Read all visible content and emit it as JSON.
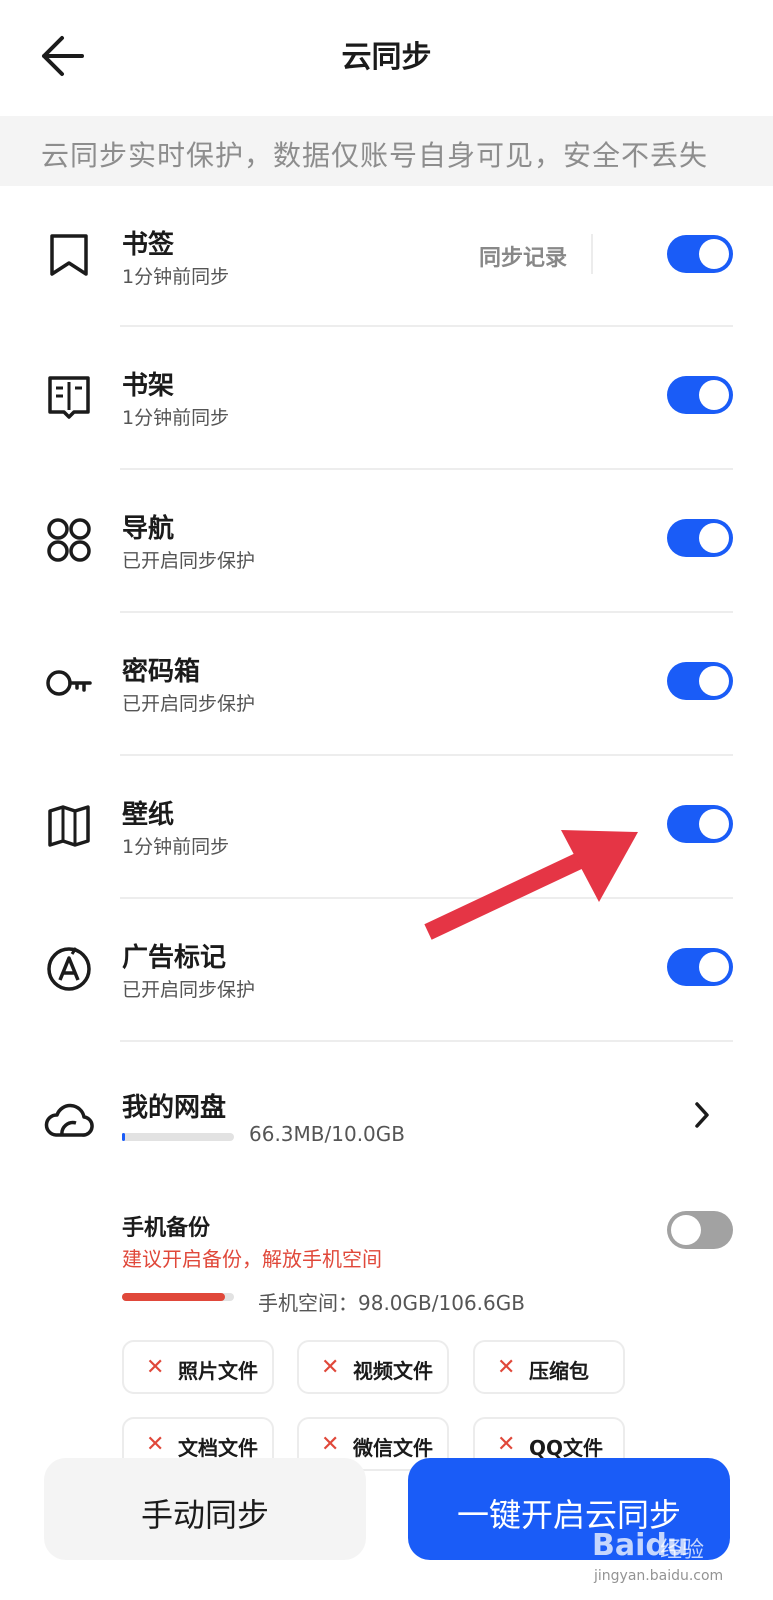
{
  "header": {
    "title": "云同步"
  },
  "notice": {
    "text": "云同步实时保护，数据仅账号自身可见，安全不丢失"
  },
  "items": [
    {
      "icon": "bookmark-icon",
      "title": "书签",
      "status": "1分钟前同步",
      "enabled": true,
      "action": "同步记录"
    },
    {
      "icon": "bookshelf-icon",
      "title": "书架",
      "status": "1分钟前同步",
      "enabled": true
    },
    {
      "icon": "navigation-grid-icon",
      "title": "导航",
      "status": "已开启同步保护",
      "enabled": true
    },
    {
      "icon": "key-icon",
      "title": "密码箱",
      "status": "已开启同步保护",
      "enabled": true
    },
    {
      "icon": "wallpaper-map-icon",
      "title": "壁纸",
      "status": "1分钟前同步",
      "enabled": true
    },
    {
      "icon": "ad-mark-icon",
      "title": "广告标记",
      "status": "已开启同步保护",
      "enabled": true
    }
  ],
  "cloud_disk": {
    "icon": "cloud-icon",
    "title": "我的网盘",
    "usage": "66.3MB/10.0GB",
    "usage_fraction": 0.0066
  },
  "phone_backup": {
    "title": "手机备份",
    "warning": "建议开启备份，解放手机空间",
    "enabled": false,
    "space_label": "手机空间：",
    "space_value": "98.0GB/106.6GB",
    "usage_fraction": 0.92,
    "categories": [
      "照片文件",
      "视频文件",
      "压缩包",
      "文档文件",
      "微信文件",
      "QQ文件"
    ]
  },
  "footer": {
    "manual_sync": "手动同步",
    "one_key_sync": "一键开启云同步"
  },
  "watermark": {
    "brand": "Baidu",
    "sub": "经验",
    "url": "jingyan.baidu.com"
  },
  "colors": {
    "accent": "#1a5cf7",
    "warning": "#e0483a",
    "arrow": "#e53545"
  }
}
